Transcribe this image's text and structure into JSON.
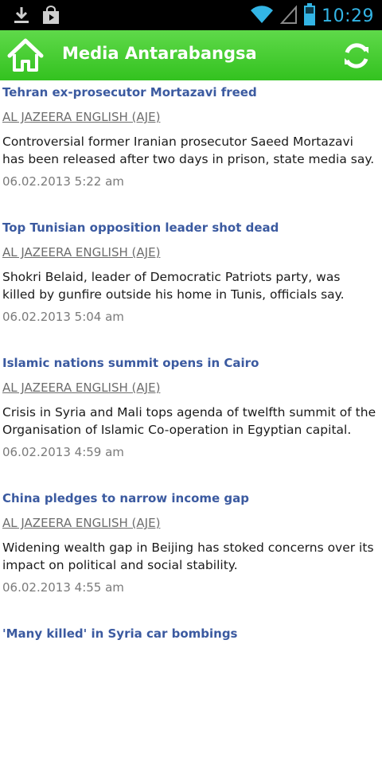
{
  "status_bar": {
    "time": "10:29",
    "icons": [
      "download-icon",
      "shopping-bag-icon",
      "wifi-icon",
      "signal-icon",
      "battery-icon"
    ]
  },
  "app_bar": {
    "title": "Media Antarabangsa",
    "home_icon": "home-icon",
    "refresh_icon": "refresh-icon",
    "accent": "#3cc426"
  },
  "articles": [
    {
      "title": "Tehran ex-prosecutor Mortazavi freed",
      "source": "AL JAZEERA ENGLISH (AJE)",
      "summary": "Controversial former Iranian prosecutor Saeed Mortazavi has been released after two days in prison, state media say.",
      "date": "06.02.2013 5:22 am"
    },
    {
      "title": "Top Tunisian opposition leader shot dead",
      "source": "AL JAZEERA ENGLISH (AJE)",
      "summary": "Shokri Belaid, leader of Democratic Patriots party, was killed by gunfire outside his home in Tunis, officials say.",
      "date": "06.02.2013 5:04 am"
    },
    {
      "title": "Islamic nations summit opens in Cairo",
      "source": "AL JAZEERA ENGLISH (AJE)",
      "summary": "Crisis in Syria and Mali tops agenda of twelfth summit of the Organisation of Islamic Co-operation in Egyptian capital.",
      "date": "06.02.2013 4:59 am"
    },
    {
      "title": "China pledges to narrow income gap",
      "source": "AL JAZEERA ENGLISH (AJE)",
      "summary": "Widening wealth gap in Beijing has stoked concerns over its impact on political and social stability.",
      "date": "06.02.2013 4:55 am"
    },
    {
      "title": "'Many killed' in Syria car bombings"
    }
  ]
}
